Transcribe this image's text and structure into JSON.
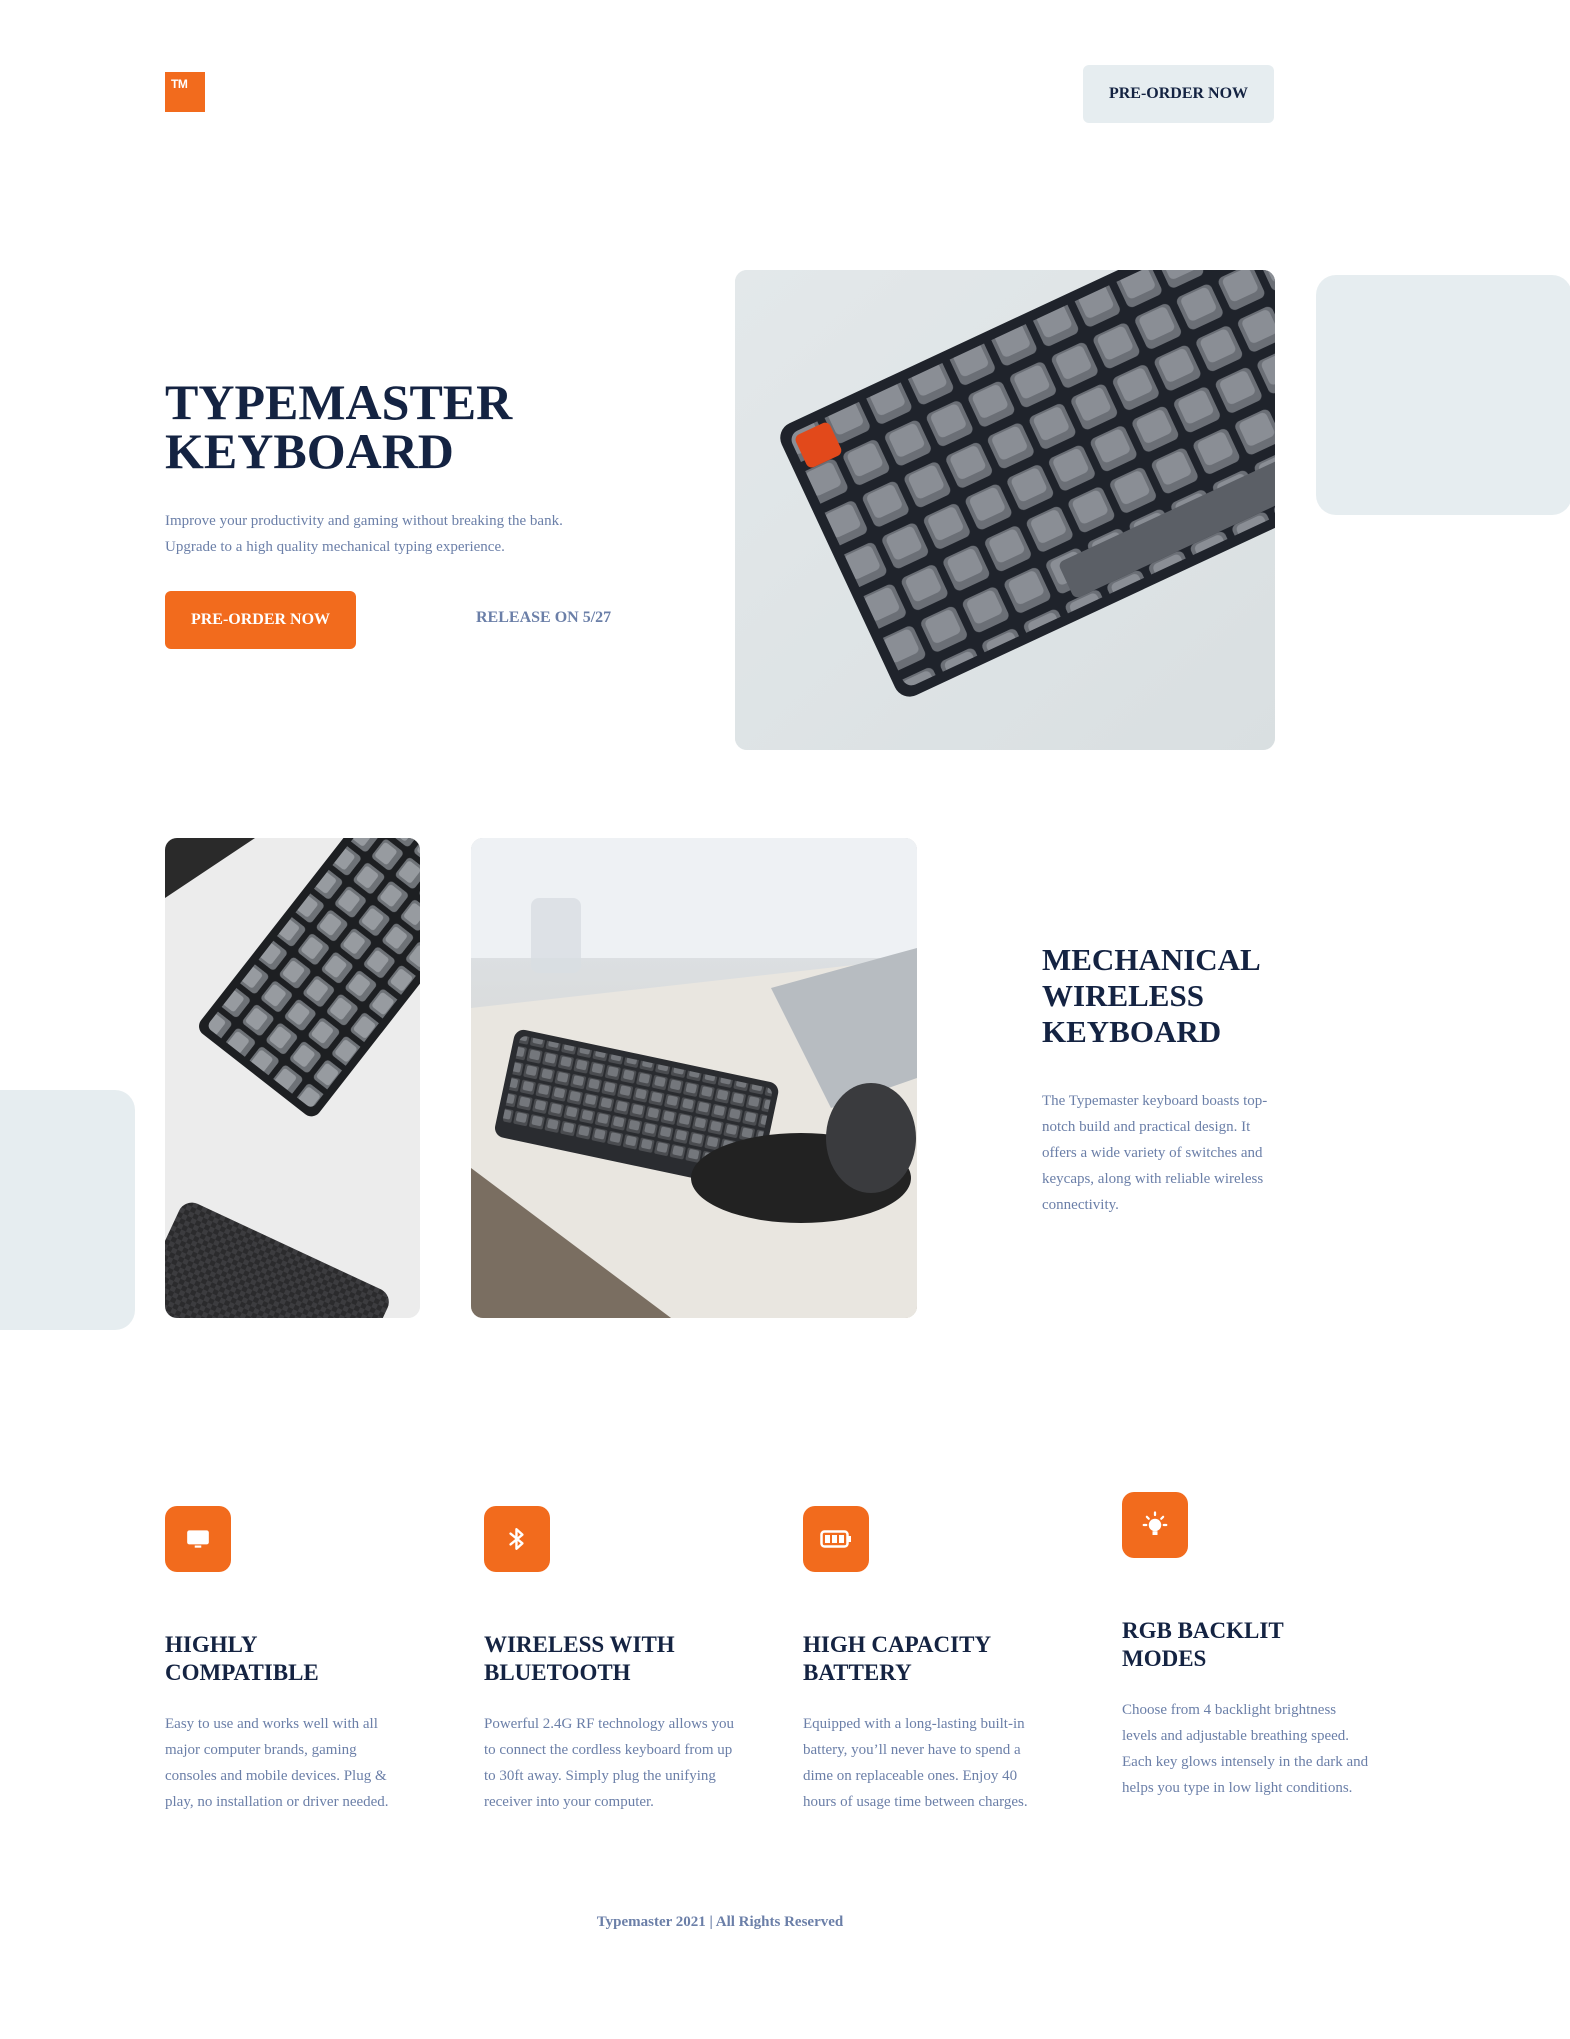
{
  "header": {
    "logo_text": "TM",
    "preorder_label": "PRE-ORDER NOW"
  },
  "hero": {
    "title_line1": "TYPEMASTER",
    "title_line2": "KEYBOARD",
    "desc_line1": "Improve your productivity and gaming without breaking the bank.",
    "desc_line2": "Upgrade to a high quality mechanical typing experience.",
    "preorder_label": "PRE-ORDER NOW",
    "release_label": "RELEASE ON 5/27"
  },
  "about": {
    "title_line1": "MECHANICAL",
    "title_line2": "WIRELESS",
    "title_line3": "KEYBOARD",
    "description": "The Typemaster keyboard boasts top-notch build and practical design. It offers a wide variety of switches and keycaps, along with reliable wireless connectivity."
  },
  "features": [
    {
      "icon": "monitor-icon",
      "title_line1": "HIGHLY",
      "title_line2": "COMPATIBLE",
      "description": "Easy to use and works well with all major computer brands, gaming consoles and mobile devices. Plug & play, no installation or driver needed."
    },
    {
      "icon": "bluetooth-icon",
      "title_line1": "WIRELESS WITH",
      "title_line2": "BLUETOOTH",
      "description": "Powerful 2.4G RF technology allows you to connect the cordless keyboard from up to 30ft away. Simply plug the unifying receiver into your computer."
    },
    {
      "icon": "battery-icon",
      "title_line1": "HIGH CAPACITY",
      "title_line2": "BATTERY",
      "description": "Equipped with a long-lasting built-in battery, you’ll never have to spend a dime on replaceable ones. Enjoy 40 hours of usage time between charges."
    },
    {
      "icon": "lightbulb-icon",
      "title_line1": "RGB BACKLIT",
      "title_line2": "MODES",
      "description": "Choose from 4 backlight brightness levels and adjustable breathing speed. Each key glows intensely in the dark and helps you type in low light conditions."
    }
  ],
  "footer": {
    "copyright": "Typemaster 2021 | All Rights Reserved"
  },
  "colors": {
    "accent": "#f26b1d",
    "heading": "#142342",
    "body_text": "#6b7fa8",
    "light_panel": "#e6edf0"
  }
}
